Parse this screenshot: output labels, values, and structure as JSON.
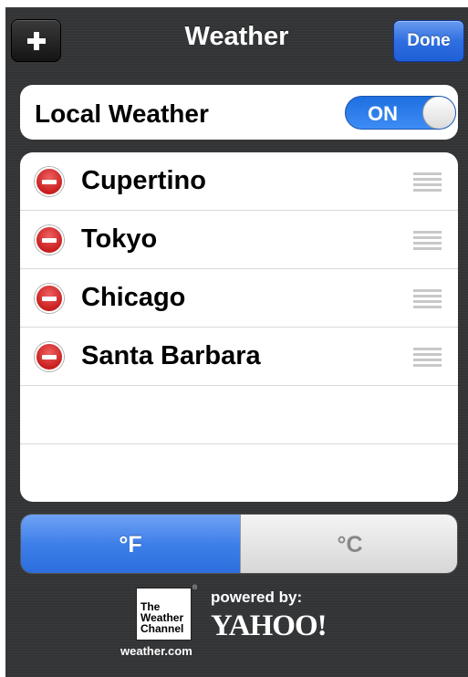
{
  "navbar": {
    "title": "Weather",
    "add_icon": "plus-icon",
    "done_label": "Done"
  },
  "local_weather": {
    "label": "Local Weather",
    "toggle_label": "ON",
    "enabled": true
  },
  "cities": [
    {
      "name": "Cupertino"
    },
    {
      "name": "Tokyo"
    },
    {
      "name": "Chicago"
    },
    {
      "name": "Santa Barbara"
    }
  ],
  "units": {
    "fahrenheit_label": "°F",
    "celsius_label": "°C",
    "selected": "F"
  },
  "footer": {
    "twc_logo_lines": [
      "The",
      "Weather",
      "Channel"
    ],
    "twc_registered": "®",
    "site": "weather.com",
    "powered_by": "powered by:",
    "yahoo_logo": "YAHOO!"
  },
  "colors": {
    "accent_blue": "#2f6fe0",
    "delete_red": "#c81f1f",
    "background": "#333436"
  }
}
